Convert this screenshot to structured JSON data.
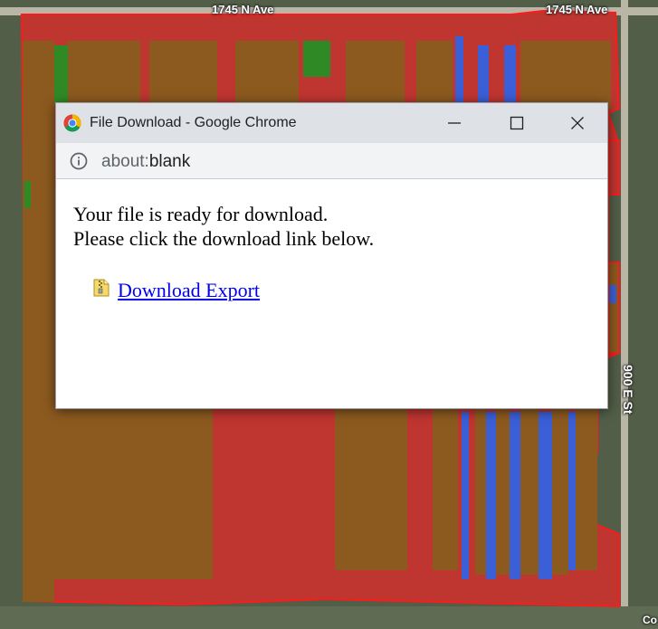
{
  "map": {
    "road_labels": [
      "1745 N Ave",
      "1745 N Ave",
      "900 E St",
      "Co"
    ]
  },
  "window": {
    "title": "File Download - Google Chrome",
    "controls": {
      "minimize_icon": "minimize-icon",
      "maximize_icon": "maximize-icon",
      "close_icon": "close-icon"
    },
    "address": {
      "scheme": "about:",
      "host": "blank",
      "icon": "info-icon"
    }
  },
  "content": {
    "line1": "Your file is ready for download.",
    "line2": "Please click the download link below.",
    "link_text": "Download Export",
    "link_icon": "zip-file-icon",
    "link_color": "#0000ee"
  },
  "colors": {
    "field_brown": "#8c5a1f",
    "field_red": "#bf3530",
    "field_blue": "#3a5fd6",
    "field_green": "#2f8a25",
    "titlebar": "#dee1e6"
  }
}
